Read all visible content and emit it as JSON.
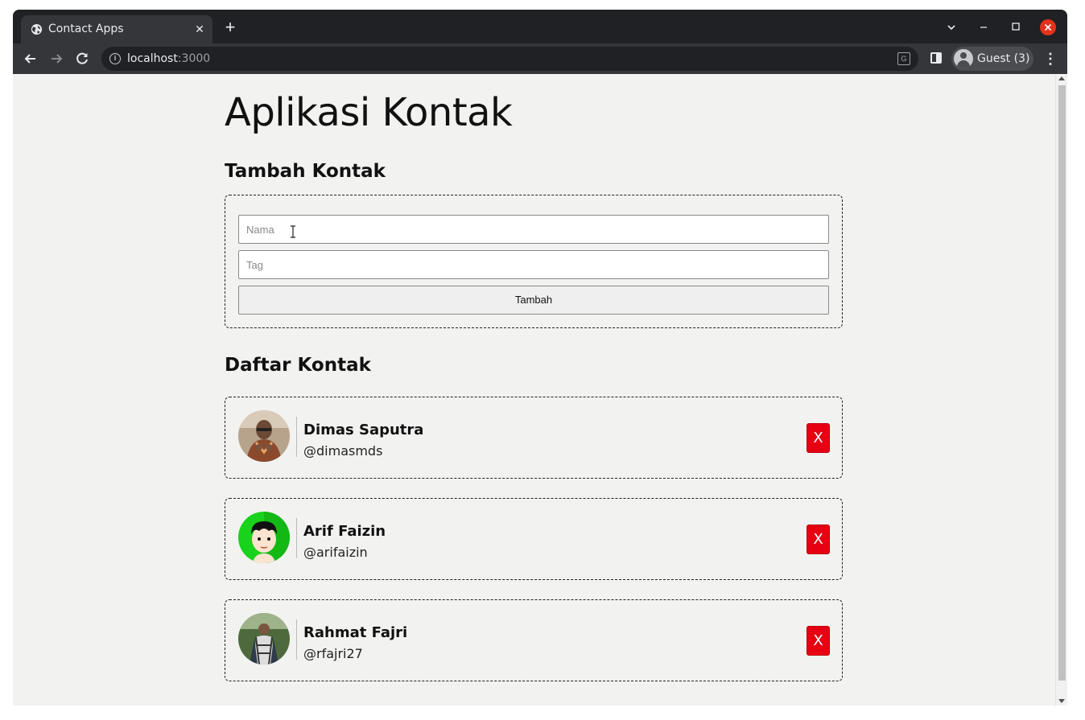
{
  "browser": {
    "tab_title": "Contact Apps",
    "tab_close": "✕",
    "new_tab": "+",
    "url_host": "localhost",
    "url_port": ":3000",
    "profile_label": "Guest (3)"
  },
  "page": {
    "title": "Aplikasi Kontak",
    "form_heading": "Tambah Kontak",
    "name_placeholder": "Nama",
    "tag_placeholder": "Tag",
    "submit_label": "Tambah",
    "list_heading": "Daftar Kontak",
    "delete_label": "X"
  },
  "contacts": [
    {
      "name": "Dimas Saputra",
      "tag": "@dimasmds",
      "avatar": "photo-man-glasses"
    },
    {
      "name": "Arif Faizin",
      "tag": "@arifaizin",
      "avatar": "cartoon-green"
    },
    {
      "name": "Rahmat Fajri",
      "tag": "@rfajri27",
      "avatar": "photo-man-outdoor"
    }
  ],
  "colors": {
    "delete_button": "#e60012",
    "page_background": "#f2f2f1",
    "browser_chrome": "#35363a"
  }
}
